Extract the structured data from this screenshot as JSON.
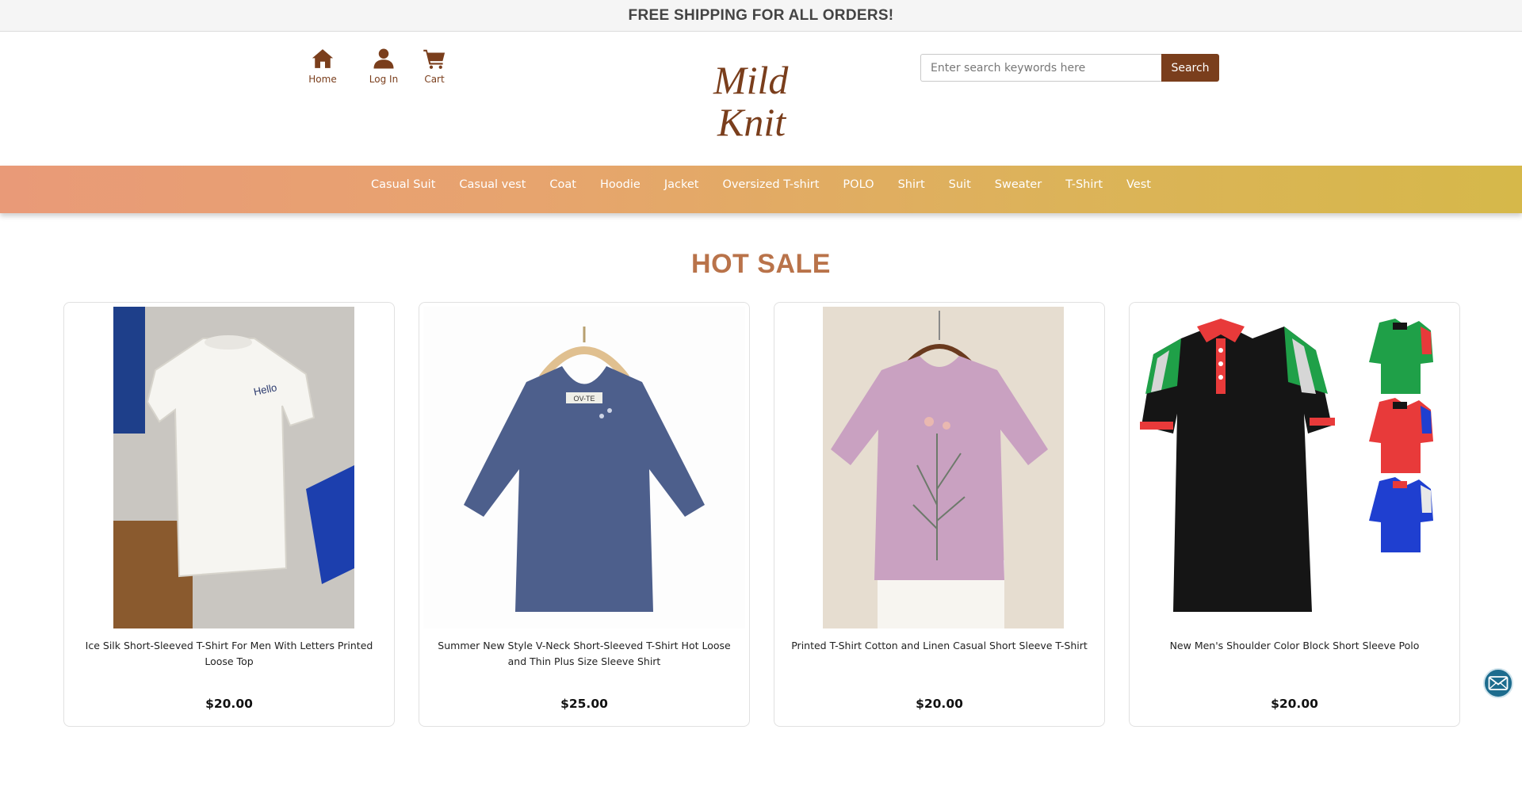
{
  "announcement": "FREE SHIPPING FOR ALL ORDERS!",
  "header": {
    "nav": [
      {
        "label": "Home",
        "icon": "home-icon"
      },
      {
        "label": "Log In",
        "icon": "user-icon"
      },
      {
        "label": "Cart",
        "icon": "cart-icon"
      }
    ],
    "logo_line1": "Mild",
    "logo_line2": "Knit",
    "search": {
      "placeholder": "Enter search keywords here",
      "button_label": "Search"
    }
  },
  "categories": [
    "Casual Suit",
    "Casual vest",
    "Coat",
    "Hoodie",
    "Jacket",
    "Oversized T-shirt",
    "POLO",
    "Shirt",
    "Suit",
    "Sweater",
    "T-Shirt",
    "Vest"
  ],
  "section_title": "HOT SALE",
  "products": [
    {
      "name": "Ice Silk Short-Sleeved T-Shirt For Men With Letters Printed Loose Top",
      "price": "$20.00",
      "image_text": "Hello"
    },
    {
      "name": "Summer New Style V-Neck Short-Sleeved T-Shirt Hot Loose and Thin Plus Size Sleeve Shirt",
      "price": "$25.00",
      "image_text": "OV-TE"
    },
    {
      "name": "Printed T-Shirt Cotton and Linen Casual Short Sleeve T-Shirt",
      "price": "$20.00"
    },
    {
      "name": "New Men's Shoulder Color Block Short Sleeve Polo",
      "price": "$20.00"
    }
  ],
  "colors": {
    "brand_brown": "#7a3e1c",
    "title_accent": "#b9734a",
    "bar_start": "#e99a78",
    "bar_end": "#d6b84a"
  },
  "floating_button_icon": "mail-icon"
}
